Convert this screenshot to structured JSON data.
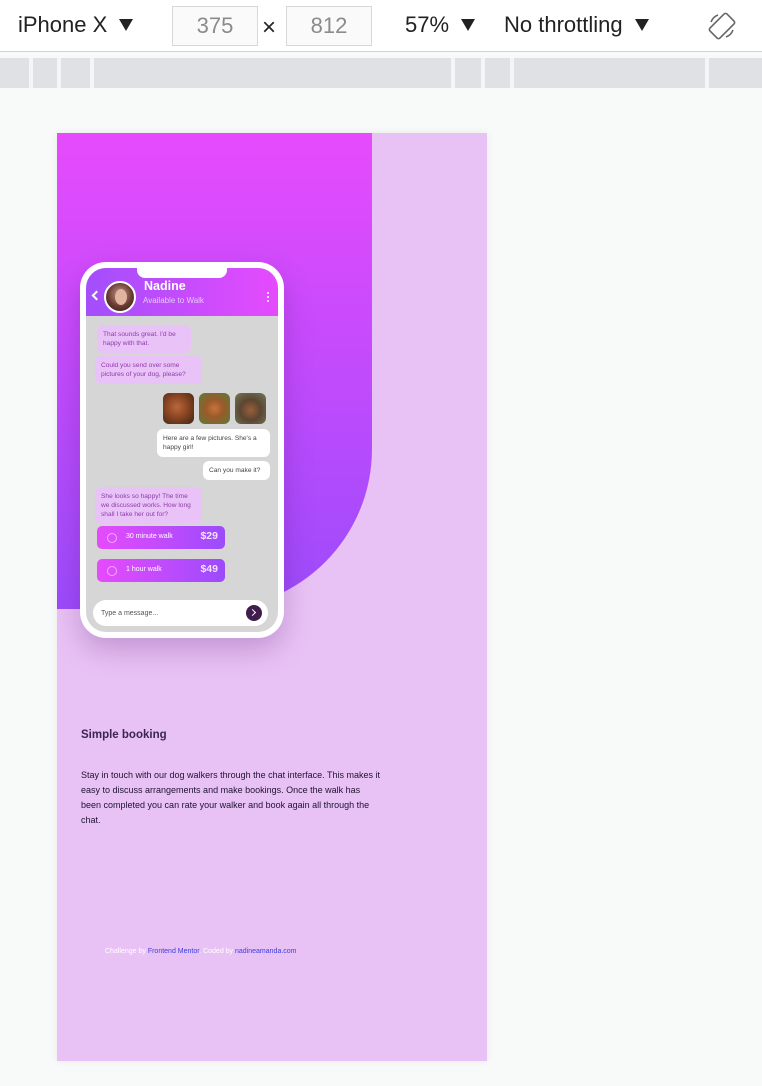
{
  "toolbar": {
    "device": "iPhone X",
    "width": "375",
    "height": "812",
    "times": "×",
    "zoom": "57%",
    "throttle": "No throttling",
    "rotate_icon": "rotate-icon"
  },
  "chat": {
    "contact_name": "Nadine",
    "contact_status": "Available to Walk",
    "messages": [
      {
        "from": "walker",
        "text": "That sounds great. I'd be happy with that."
      },
      {
        "from": "walker",
        "text": "Could you send over some pictures of your dog, please?"
      },
      {
        "from": "owner",
        "text": "Here are a few pictures. She's a happy girl!"
      },
      {
        "from": "owner",
        "text": "Can you make it?"
      },
      {
        "from": "walker",
        "text": "She looks so happy! The time we discussed works. How long shall I take her out for?"
      }
    ],
    "options": [
      {
        "label": "30 minute walk",
        "price": "$29"
      },
      {
        "label": "1 hour walk",
        "price": "$49"
      }
    ],
    "input_placeholder": "Type a message..."
  },
  "content": {
    "heading": "Simple booking",
    "body": "Stay in touch with our dog walkers through the chat interface. This makes it easy to discuss arrangements and make bookings. Once the walk has been completed you can rate your walker and book again all through the chat."
  },
  "footer": {
    "challenge_prefix": "Challenge by",
    "challenge_link": "Frontend Mentor",
    "coded_prefix": "Coded by",
    "coded_link": "nadineamanda.com"
  },
  "colors": {
    "gradient_start": "#e64bfd",
    "gradient_end": "#9c4bfb",
    "page_background": "#e9c2f5",
    "incoming_bubble": "#e9c3f8",
    "outgoing_bubble": "#ffffff"
  }
}
